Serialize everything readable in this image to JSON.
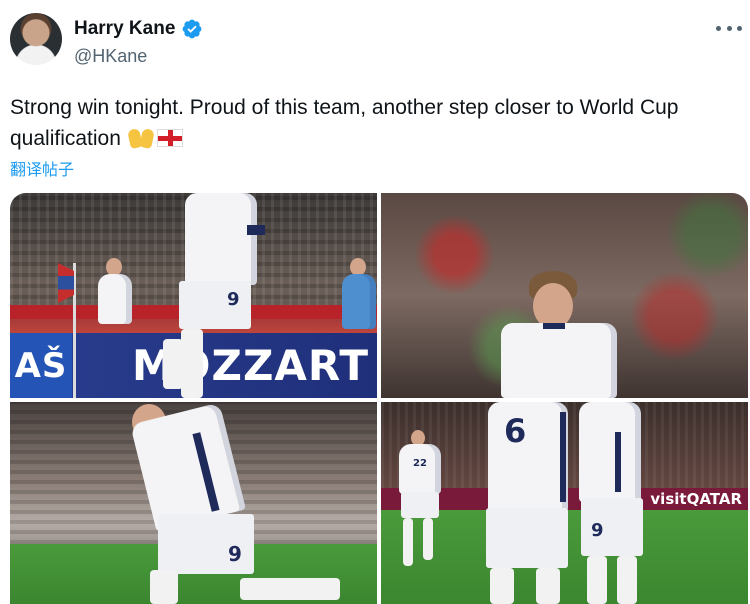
{
  "tweet": {
    "author_name": "Harry Kane",
    "author_handle": "@HKane",
    "verified": true,
    "text": "Strong win tonight. Proud of this team, another step closer to World Cup qualification",
    "translate_label": "翻译帖子"
  },
  "media": {
    "adboard_main": "MOZZART",
    "adboard_left": "AŠ",
    "adboard_qatar": "visitQATAR",
    "shirt_numbers": [
      "9",
      "9",
      "6",
      "9",
      "22"
    ]
  },
  "icons": {
    "verified": "verified-badge-icon",
    "more": "more-options-icon",
    "emoji_1": "raising-hands-emoji",
    "emoji_2": "england-flag-emoji"
  },
  "colors": {
    "link": "#1d9bf0",
    "verified": "#1d9bf0",
    "secondary_text": "#536471"
  }
}
